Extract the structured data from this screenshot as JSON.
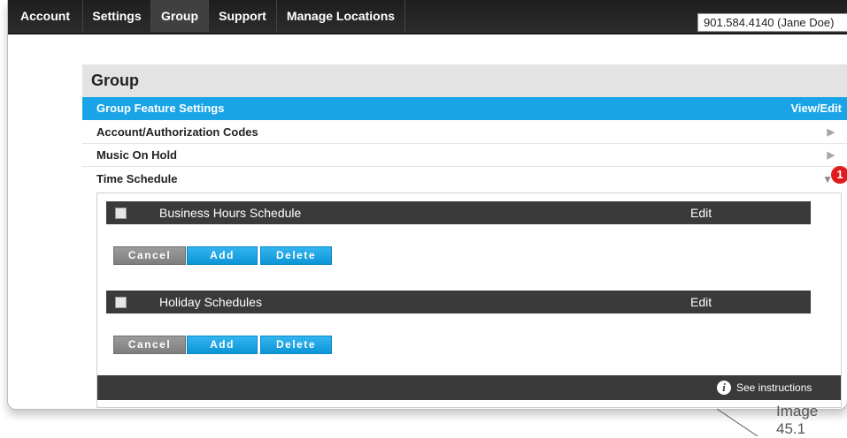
{
  "nav": {
    "tabs": [
      {
        "label": "Account"
      },
      {
        "label": "Settings"
      },
      {
        "label": "Group"
      },
      {
        "label": "Support"
      },
      {
        "label": "Manage Locations"
      }
    ],
    "active_tab": "Group",
    "account_selector": "901.584.4140 (Jane Doe)"
  },
  "section": {
    "title": "Group",
    "header_row": {
      "label": "Group Feature Settings",
      "action": "View/Edit"
    },
    "rows": [
      {
        "label": "Account/Authorization Codes",
        "icon": "triangle-right-icon"
      },
      {
        "label": "Music On Hold",
        "icon": "triangle-right-icon"
      },
      {
        "label": "Time Schedule",
        "icon": "triangle-down-icon",
        "badge": "1"
      }
    ]
  },
  "schedules": [
    {
      "name": "Business Hours Schedule",
      "edit": "Edit",
      "buttons": {
        "cancel": "Cancel",
        "add": "Add",
        "delete": "Delete"
      }
    },
    {
      "name": "Holiday Schedules",
      "edit": "Edit",
      "buttons": {
        "cancel": "Cancel",
        "add": "Add",
        "delete": "Delete"
      }
    }
  ],
  "footer": {
    "instructions": "See instructions",
    "icon": "info-icon"
  },
  "caption": "Image 45.1",
  "colors": {
    "nav_bg": "#222222",
    "accent_blue": "#1aa4e8",
    "bar_dark": "#3a3a3a",
    "badge_red": "#e01b1b"
  }
}
